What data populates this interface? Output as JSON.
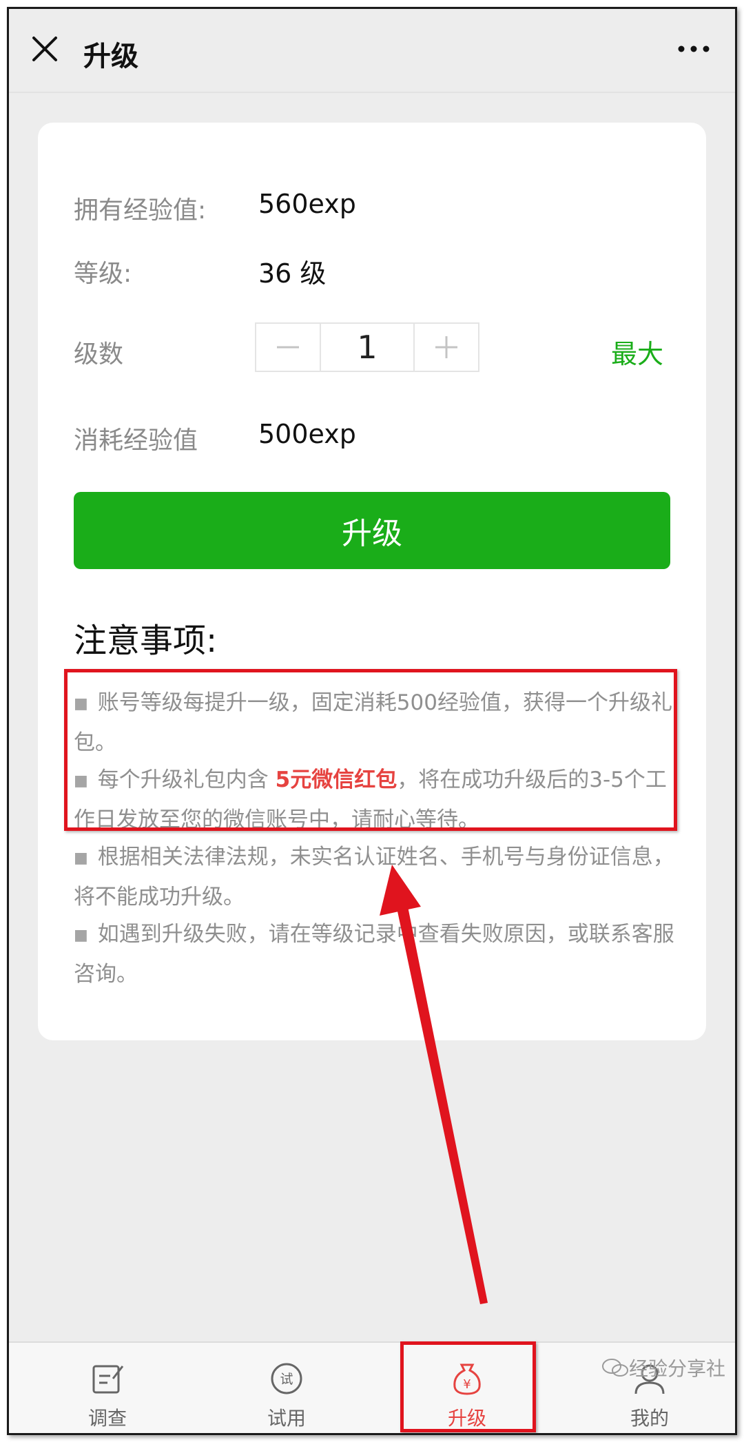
{
  "header": {
    "title": "升级"
  },
  "card": {
    "exp_label": "拥有经验值:",
    "exp_value": "560exp",
    "level_label": "等级:",
    "level_value": "36 级",
    "count_label": "级数",
    "count_value": "1",
    "max_label": "最大",
    "cost_label": "消耗经验值",
    "cost_value": "500exp",
    "upgrade_button": "升级"
  },
  "notes": {
    "title": "注意事项:",
    "items": [
      {
        "text": "账号等级每提升一级，固定消耗500经验值，获得一个升级礼包。"
      },
      {
        "pre": "每个升级礼包内含 ",
        "highlight": "5元微信红包",
        "post": "，将在成功升级后的3-5个工作日发放至您的微信账号中，请耐心等待。"
      },
      {
        "text": "根据相关法律法规，未实名认证姓名、手机号与身份证信息，将不能成功升级。"
      },
      {
        "text": "如遇到升级失败，请在等级记录中查看失败原因，或联系客服咨询。"
      }
    ]
  },
  "tabs": [
    {
      "label": "调查",
      "icon": "edit-icon"
    },
    {
      "label": "试用",
      "icon": "trial-icon"
    },
    {
      "label": "升级",
      "icon": "money-bag-icon"
    },
    {
      "label": "我的",
      "icon": "user-icon"
    }
  ],
  "watermark": "经验分享社",
  "colors": {
    "accent": "#1aad19",
    "highlight": "#e64340",
    "annotation": "#e0141e"
  }
}
